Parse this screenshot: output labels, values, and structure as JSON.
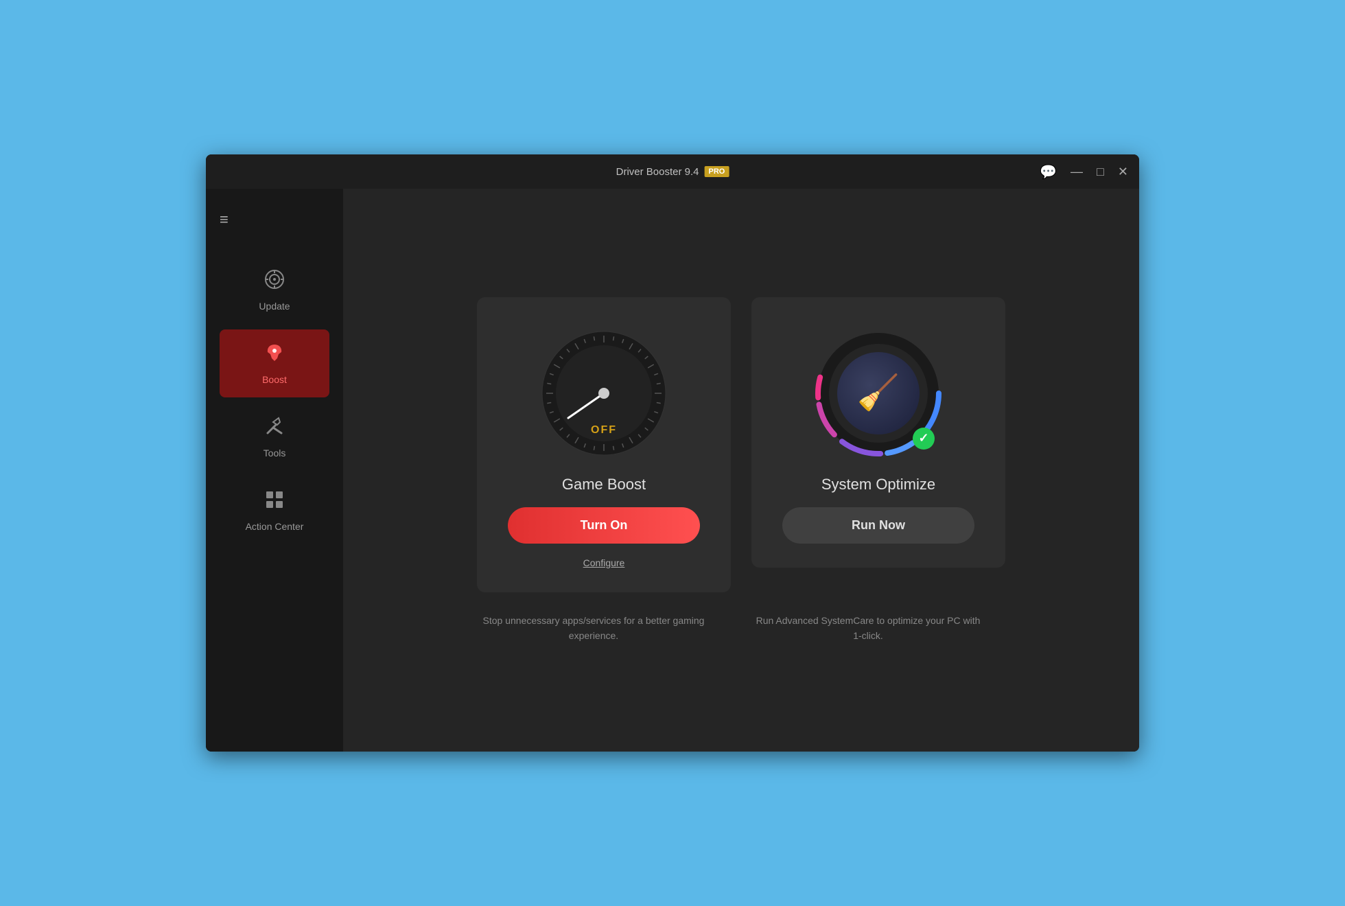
{
  "window": {
    "title": "Driver Booster 9.4",
    "pro_badge": "PRO"
  },
  "titlebar": {
    "minimize": "—",
    "maximize": "□",
    "close": "✕"
  },
  "sidebar": {
    "hamburger": "≡",
    "items": [
      {
        "id": "update",
        "label": "Update",
        "icon": "⚙",
        "active": false
      },
      {
        "id": "boost",
        "label": "Boost",
        "icon": "🚀",
        "active": true
      },
      {
        "id": "tools",
        "label": "Tools",
        "icon": "🔧",
        "active": false
      },
      {
        "id": "action-center",
        "label": "Action Center",
        "icon": "⊞",
        "active": false
      }
    ]
  },
  "game_boost_card": {
    "gauge_status": "OFF",
    "title": "Game Boost",
    "turn_on_label": "Turn On",
    "configure_label": "Configure",
    "description": "Stop unnecessary apps/services for a better gaming experience."
  },
  "system_optimize_card": {
    "title": "System Optimize",
    "run_now_label": "Run Now",
    "description": "Run Advanced SystemCare to optimize your PC with 1-click."
  }
}
